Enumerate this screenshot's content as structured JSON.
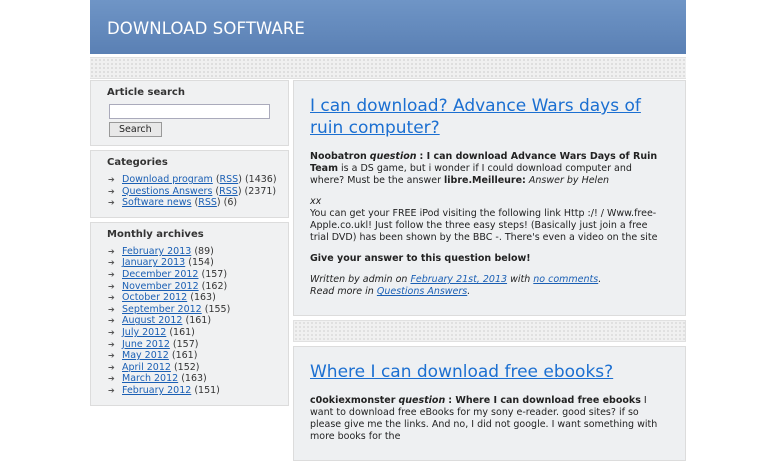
{
  "site": {
    "title": "DOWNLOAD SOFTWARE"
  },
  "search": {
    "heading": "Article search",
    "input_value": "",
    "button_label": "Search"
  },
  "categories": {
    "heading": "Categories",
    "items": [
      {
        "label": "Download program",
        "rss": "RSS",
        "count": "(1436)"
      },
      {
        "label": "Questions Answers",
        "rss": "RSS",
        "count": "(2371)"
      },
      {
        "label": "Software news",
        "rss": "RSS",
        "count": "(6)"
      }
    ]
  },
  "archives": {
    "heading": "Monthly archives",
    "items": [
      {
        "label": "February 2013",
        "count": "(89)"
      },
      {
        "label": "January 2013",
        "count": "(154)"
      },
      {
        "label": "December 2012",
        "count": "(157)"
      },
      {
        "label": "November 2012",
        "count": "(162)"
      },
      {
        "label": "October 2012",
        "count": "(163)"
      },
      {
        "label": "September 2012",
        "count": "(155)"
      },
      {
        "label": "August 2012",
        "count": "(161)"
      },
      {
        "label": "July 2012",
        "count": "(161)"
      },
      {
        "label": "June 2012",
        "count": "(157)"
      },
      {
        "label": "May 2012",
        "count": "(161)"
      },
      {
        "label": "April 2012",
        "count": "(152)"
      },
      {
        "label": "March 2012",
        "count": "(163)"
      },
      {
        "label": "February 2012",
        "count": "(151)"
      }
    ]
  },
  "posts": [
    {
      "title": "I can download? Advance Wars days of ruin computer?",
      "asker": "Noobatron",
      "question_word": "question",
      "question_text": ": I can download Advance Wars Days of Ruin Team",
      "question_rest": "is a DS game, but i wonder if I could download computer and where? Must be the answer",
      "answer_bold": "libre.Meilleure:",
      "answer_by": "Answer by Helen",
      "xx": "xx",
      "body": "You can get your FREE iPod visiting the following link Http :/! / Www.free-Apple.co.ukl! Just follow the three easy steps! (Basically just join a free trial DVD) has been shown by the BBC -. There's even a video on the site",
      "cta": "Give your answer to this question below!",
      "written_by": "Written by admin on",
      "date": "February 21st, 2013",
      "with": "with",
      "comments": "no comments",
      "read_more": "Read more in",
      "category": "Questions Answers"
    },
    {
      "title": "Where I can download free ebooks?",
      "asker": "c0okiexmonster",
      "question_word": "question",
      "question_text": ": Where I can download free ebooks",
      "question_rest": "I want to download free eBooks for my sony e-reader. good sites? if so please give me the links. And no, I did not google. I want something with more books for the"
    }
  ]
}
